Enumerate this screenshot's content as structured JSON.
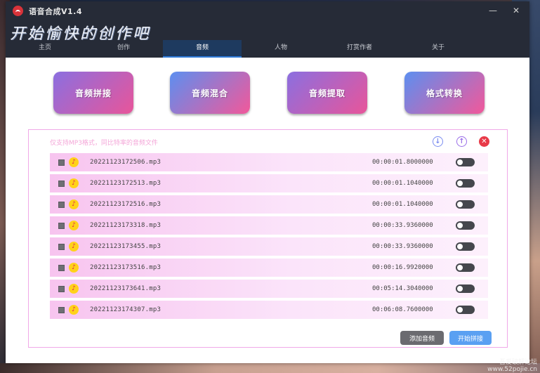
{
  "window": {
    "title": "语音合成V1.4",
    "slogan": "开始愉快的创作吧",
    "minimize_glyph": "—",
    "close_glyph": "✕"
  },
  "tabs": [
    {
      "label": "主页",
      "active": false
    },
    {
      "label": "创作",
      "active": false
    },
    {
      "label": "音频",
      "active": true
    },
    {
      "label": "人物",
      "active": false
    },
    {
      "label": "打赏作者",
      "active": false
    },
    {
      "label": "关于",
      "active": false
    }
  ],
  "functions": [
    {
      "label": "音频拼接"
    },
    {
      "label": "音频混合"
    },
    {
      "label": "音频提取"
    },
    {
      "label": "格式转换"
    }
  ],
  "panel": {
    "hint": "仅支持MP3格式，同比特率的音频文件",
    "icons": {
      "down": "download-icon",
      "up": "upload-icon",
      "delete": "delete-icon"
    }
  },
  "files": [
    {
      "name": "20221123172506.mp3",
      "duration": "00:00:01.8000000"
    },
    {
      "name": "20221123172513.mp3",
      "duration": "00:00:01.1040000"
    },
    {
      "name": "20221123172516.mp3",
      "duration": "00:00:01.1040000"
    },
    {
      "name": "20221123173318.mp3",
      "duration": "00:00:33.9360000"
    },
    {
      "name": "20221123173455.mp3",
      "duration": "00:00:33.9360000"
    },
    {
      "name": "20221123173516.mp3",
      "duration": "00:00:16.9920000"
    },
    {
      "name": "20221123173641.mp3",
      "duration": "00:05:14.3040000"
    },
    {
      "name": "20221123174307.mp3",
      "duration": "00:06:08.7600000"
    }
  ],
  "actions": {
    "add": "添加音频",
    "start": "开始拼接"
  },
  "watermark": {
    "line1": "吾爱破解论坛",
    "line2": "www.52pojie.cn"
  },
  "colors": {
    "titlebar": "#262b37",
    "accent_blue": "#5aa0f2",
    "panel_border": "#f0a8e8",
    "row_pink": "#f7c4ef",
    "delete_red": "#e83a48"
  }
}
